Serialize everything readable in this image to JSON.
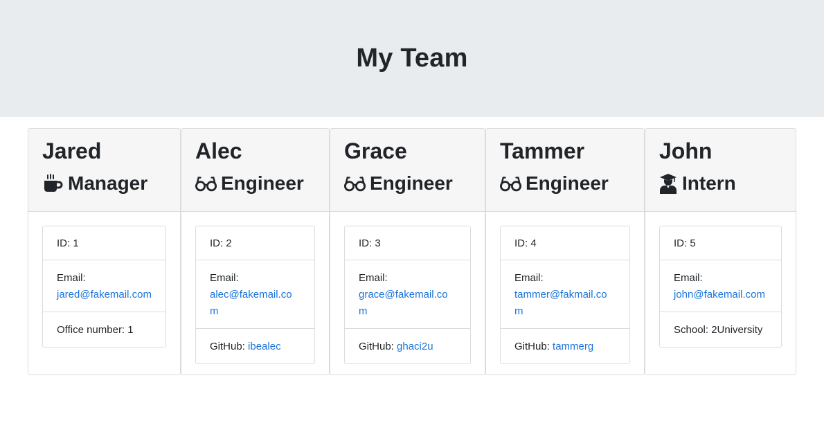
{
  "header": {
    "title": "My Team"
  },
  "colors": {
    "link": "#1a73d9",
    "header_bg": "#e9ecef"
  },
  "cards": [
    {
      "name": "Jared",
      "role": "Manager",
      "icon": "mug-icon",
      "id_text": "ID: 1",
      "email_label": "Email:",
      "email": "jared@fakemail.com",
      "extra_label": "Office number: 1",
      "extra_value": ""
    },
    {
      "name": "Alec",
      "role": "Engineer",
      "icon": "glasses-icon",
      "id_text": "ID: 2",
      "email_label": "Email:",
      "email": "alec@fakemail.com",
      "extra_label": "GitHub: ",
      "extra_value": "ibealec"
    },
    {
      "name": "Grace",
      "role": "Engineer",
      "icon": "glasses-icon",
      "id_text": "ID: 3",
      "email_label": "Email:",
      "email": "grace@fakemail.com",
      "extra_label": "GitHub: ",
      "extra_value": "ghaci2u"
    },
    {
      "name": "Tammer",
      "role": "Engineer",
      "icon": "glasses-icon",
      "id_text": "ID: 4",
      "email_label": "Email:",
      "email": "tammer@fakmail.com",
      "extra_label": "GitHub: ",
      "extra_value": "tammerg"
    },
    {
      "name": "John",
      "role": "Intern",
      "icon": "graduate-icon",
      "id_text": "ID: 5",
      "email_label": "Email:",
      "email": "john@fakemail.com",
      "extra_label": "School: 2University",
      "extra_value": ""
    }
  ]
}
